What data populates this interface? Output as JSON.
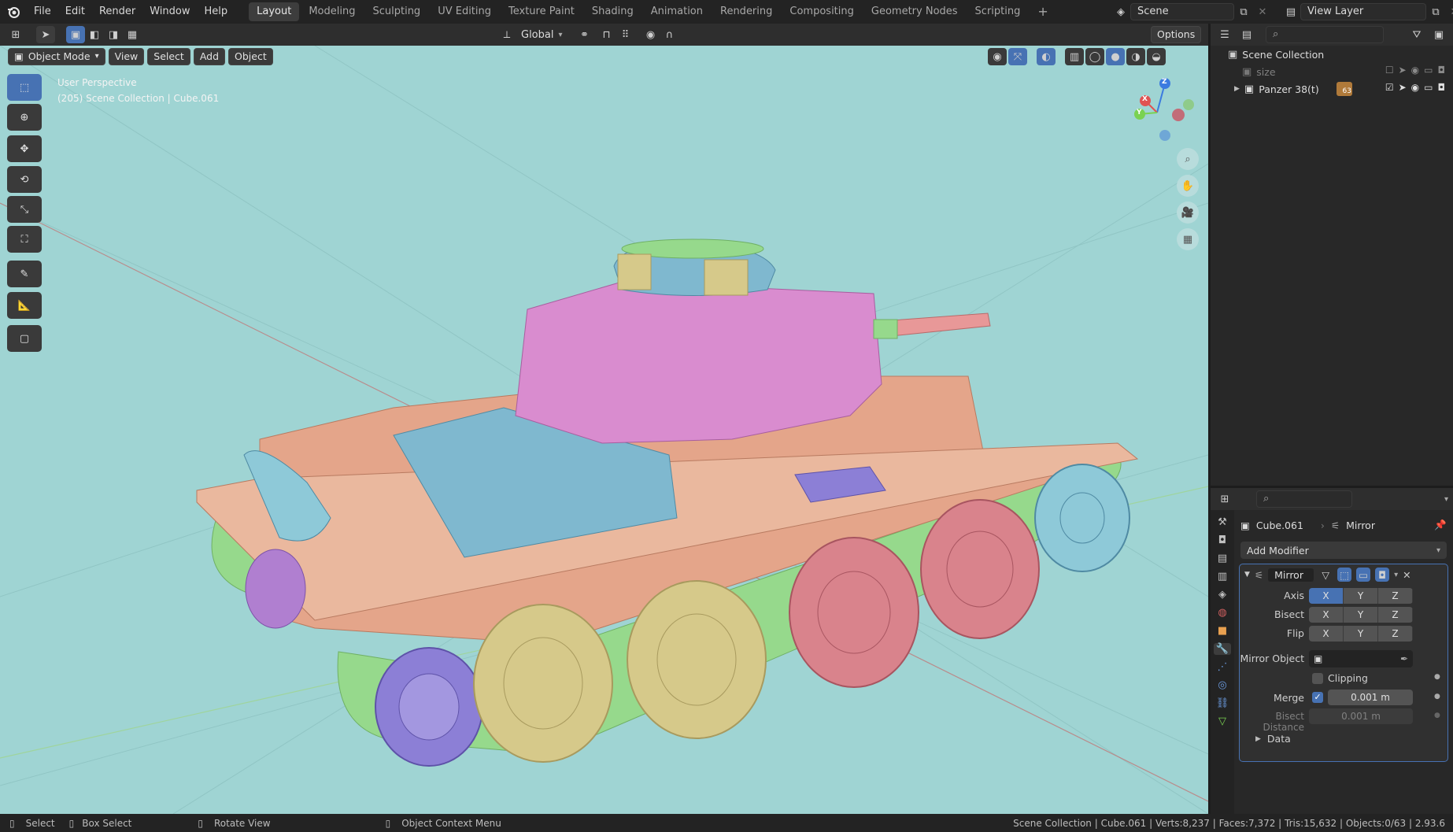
{
  "menu": {
    "items": [
      "File",
      "Edit",
      "Render",
      "Window",
      "Help"
    ]
  },
  "workspaces": {
    "tabs": [
      "Layout",
      "Modeling",
      "Sculpting",
      "UV Editing",
      "Texture Paint",
      "Shading",
      "Animation",
      "Rendering",
      "Compositing",
      "Geometry Nodes",
      "Scripting"
    ],
    "active": "Layout",
    "add": "+"
  },
  "scene": {
    "name": "Scene",
    "view_layer": "View Layer"
  },
  "viewport_header": {
    "mode": "Object Mode",
    "menus": [
      "View",
      "Select",
      "Add",
      "Object"
    ],
    "transform_orientation": "Global",
    "options": "Options"
  },
  "viewport_overlay": {
    "perspective": "User Perspective",
    "context": "(205) Scene Collection | Cube.061"
  },
  "gizmo": {
    "x": "X",
    "y": "Y",
    "z": "Z"
  },
  "outliner": {
    "root": "Scene Collection",
    "items": [
      {
        "name": "size",
        "dimmed": true
      },
      {
        "name": "Panzer 38(t)",
        "dimmed": false,
        "badge": "63"
      }
    ]
  },
  "properties": {
    "object_name": "Cube.061",
    "modifier_breadcrumb": "Mirror",
    "add_modifier": "Add Modifier",
    "modifier": {
      "name": "Mirror",
      "axis_label": "Axis",
      "bisect_label": "Bisect",
      "flip_label": "Flip",
      "axes": [
        "X",
        "Y",
        "Z"
      ],
      "axis_active": "X",
      "mirror_object_label": "Mirror Object",
      "clipping_label": "Clipping",
      "clipping_checked": false,
      "merge_label": "Merge",
      "merge_checked": true,
      "merge_value": "0.001 m",
      "bisect_distance_label": "Bisect Distance",
      "bisect_distance_value": "0.001 m",
      "data_label": "Data"
    }
  },
  "statusbar": {
    "select": "Select",
    "box_select": "Box Select",
    "rotate_view": "Rotate View",
    "context_menu": "Object Context Menu",
    "stats": "Scene Collection | Cube.061 | Verts:8,237 | Faces:7,372 | Tris:15,632 | Objects:0/63 | 2.93.6"
  },
  "colors": {
    "viewport_bg": "#9fd4d3",
    "accent": "#4772b3",
    "hull": "#e4a58a",
    "turret": "#d98ccf",
    "track": "#96d98c",
    "wheel_yellow": "#d6c98a",
    "wheel_red": "#d9838c",
    "wheel_purple": "#8c7fd6",
    "armor_blue": "#7fb8cf"
  }
}
